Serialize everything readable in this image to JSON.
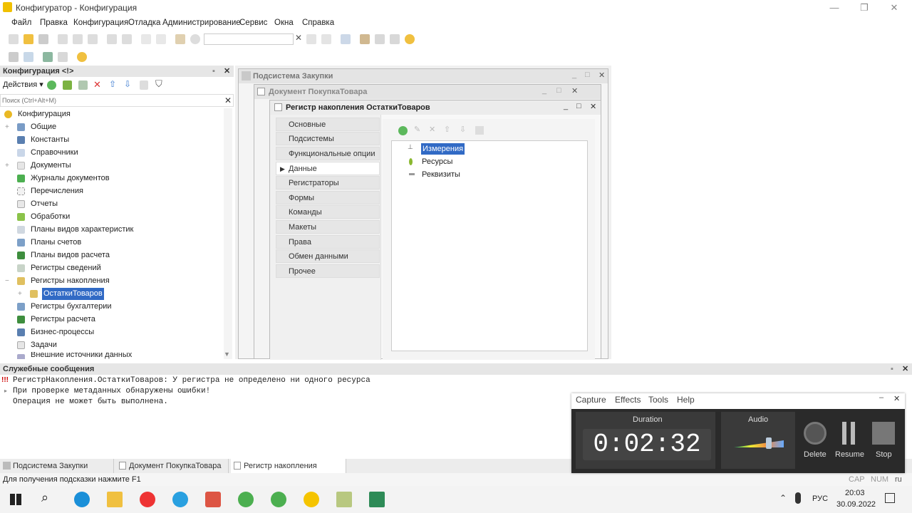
{
  "window": {
    "title": "Конфигуратор - Конфигурация",
    "minimize": "—",
    "restore": "❐",
    "close": "✕"
  },
  "menu": [
    "Файл",
    "Правка",
    "Конфигурация",
    "Отладка",
    "Администрирование",
    "Сервис",
    "Окна",
    "Справка"
  ],
  "config_panel": {
    "title": "Конфигурация <!>",
    "actions_label": "Действия",
    "search_placeholder": "Поиск (Ctrl+Alt+M)",
    "tree": [
      {
        "label": "Конфигурация",
        "level": 0
      },
      {
        "label": "Общие",
        "level": 1,
        "expand": "+"
      },
      {
        "label": "Константы",
        "level": 1
      },
      {
        "label": "Справочники",
        "level": 1
      },
      {
        "label": "Документы",
        "level": 1,
        "expand": "+"
      },
      {
        "label": "Журналы документов",
        "level": 1
      },
      {
        "label": "Перечисления",
        "level": 1
      },
      {
        "label": "Отчеты",
        "level": 1
      },
      {
        "label": "Обработки",
        "level": 1
      },
      {
        "label": "Планы видов характеристик",
        "level": 1
      },
      {
        "label": "Планы счетов",
        "level": 1
      },
      {
        "label": "Планы видов расчета",
        "level": 1
      },
      {
        "label": "Регистры сведений",
        "level": 1
      },
      {
        "label": "Регистры накопления",
        "level": 1,
        "expand": "−"
      },
      {
        "label": "ОстаткиТоваров",
        "level": 2,
        "expand": "+",
        "selected": true
      },
      {
        "label": "Регистры бухгалтерии",
        "level": 1
      },
      {
        "label": "Регистры расчета",
        "level": 1
      },
      {
        "label": "Бизнес-процессы",
        "level": 1
      },
      {
        "label": "Задачи",
        "level": 1
      },
      {
        "label": "Внешние источники данных",
        "level": 1
      }
    ]
  },
  "windows": {
    "subsystem_title": "Подсистема Закупки",
    "document_title": "Документ ПокупкаТовара",
    "register_title": "Регистр накопления ОстаткиТоваров"
  },
  "register_nav": [
    "Основные",
    "Подсистемы",
    "Функциональные опции",
    "Данные",
    "Регистраторы",
    "Формы",
    "Команды",
    "Макеты",
    "Права",
    "Обмен данными",
    "Прочее"
  ],
  "register_nav_active": 3,
  "data_tree": [
    "Измерения",
    "Ресурсы",
    "Реквизиты"
  ],
  "messages": {
    "title": "Служебные сообщения",
    "lines": [
      "РегистрНакопления.ОстаткиТоваров: У регистра не определено ни одного ресурса",
      "При проверке метаданных обнаружены ошибки!",
      "Операция не может быть выполнена."
    ]
  },
  "open_tabs": [
    "Подсистема Закупки",
    "Документ ПокупкаТовара",
    "Регистр накопления Остатк..."
  ],
  "status": {
    "hint": "Для получения подсказки нажмите F1",
    "cap": "CAP",
    "num": "NUM",
    "lang": "ru"
  },
  "recorder": {
    "menu": [
      "Capture",
      "Effects",
      "Tools",
      "Help"
    ],
    "duration_label": "Duration",
    "duration": "0:02:32",
    "audio_label": "Audio",
    "audio_level": 0.7,
    "buttons": [
      "Delete",
      "Resume",
      "Stop"
    ]
  },
  "taskbar": {
    "lang": "РУС",
    "time": "20:03",
    "date": "30.09.2022"
  }
}
